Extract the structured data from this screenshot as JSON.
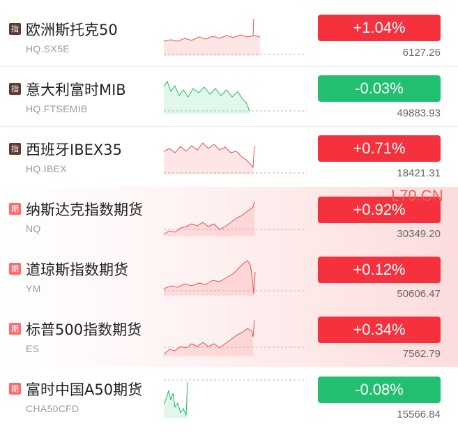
{
  "watermark": "L70.CN",
  "colors": {
    "up": "#f5313d",
    "down": "#20c070",
    "index_badge": "#5b3a33",
    "futures_badge": "#ff6b6b"
  },
  "quotes": [
    {
      "badge": "指",
      "name": "欧洲斯托克50",
      "code": "HQ.SX5E",
      "change": "+1.04%",
      "price": "6127.26",
      "direction": "up"
    },
    {
      "badge": "指",
      "name": "意大利富时MIB",
      "code": "HQ.FTSEMIB",
      "change": "-0.03%",
      "price": "49883.93",
      "direction": "down"
    },
    {
      "badge": "指",
      "name": "西班牙IBEX35",
      "code": "HQ.IBEX",
      "change": "+0.71%",
      "price": "18421.31",
      "direction": "up"
    },
    {
      "badge": "期",
      "name": "纳斯达克指数期货",
      "code": "NQ",
      "change": "+0.92%",
      "price": "30349.20",
      "direction": "up"
    },
    {
      "badge": "期",
      "name": "道琼斯指数期货",
      "code": "YM",
      "change": "+0.12%",
      "price": "50606.47",
      "direction": "up"
    },
    {
      "badge": "期",
      "name": "标普500指数期货",
      "code": "ES",
      "change": "+0.34%",
      "price": "7562.79",
      "direction": "up"
    },
    {
      "badge": "期",
      "name": "富时中国A50期货",
      "code": "CHA50CFD",
      "change": "-0.08%",
      "price": "15566.84",
      "direction": "down"
    }
  ]
}
